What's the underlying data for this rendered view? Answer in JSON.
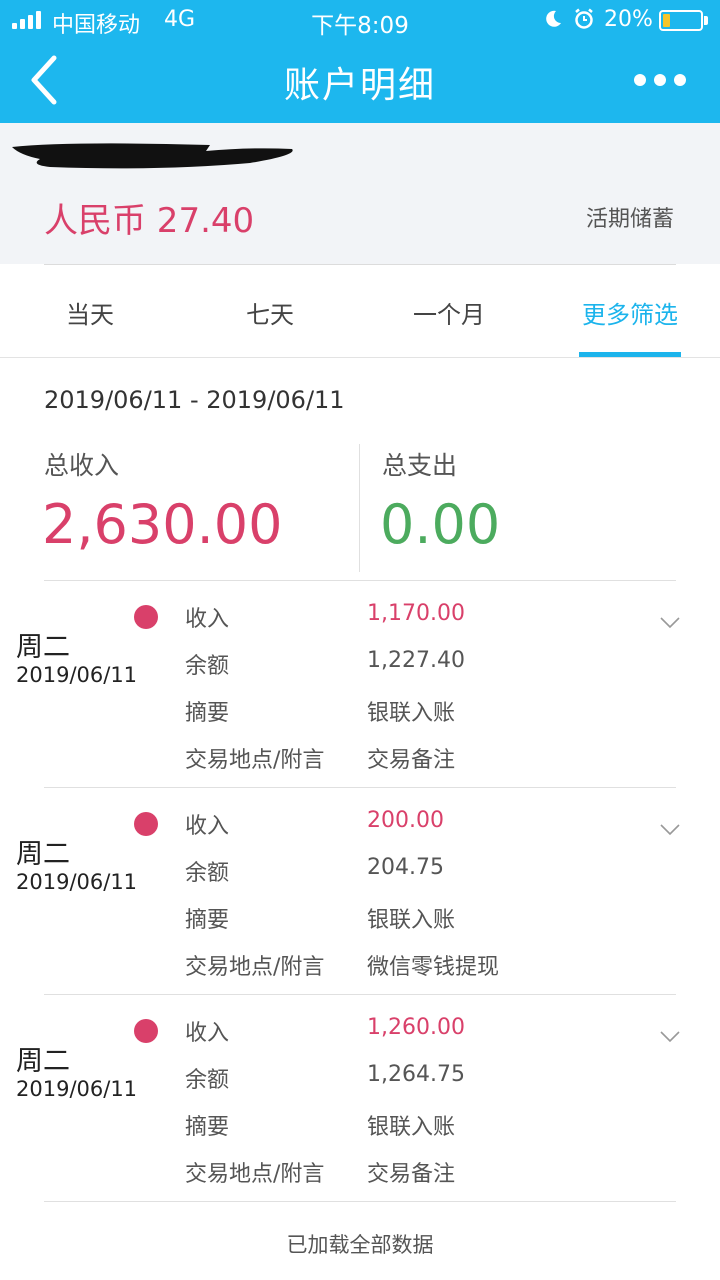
{
  "status_bar": {
    "carrier": "中国移动",
    "network": "4G",
    "time": "下午8:09",
    "battery": "20%",
    "battery_level": 0.2
  },
  "header": {
    "title": "账户明细",
    "back_icon": "chevron-left-icon",
    "more_icon": "more-dots-icon",
    "background": "#1db7ee"
  },
  "account": {
    "balance": "人民币 27.40",
    "type": "活期储蓄"
  },
  "tabs": [
    {
      "label": "当天"
    },
    {
      "label": "七天"
    },
    {
      "label": "一个月"
    },
    {
      "label": "更多筛选",
      "active": true
    }
  ],
  "summary": {
    "date_range": "2019/06/11 - 2019/06/11",
    "income_label": "总收入",
    "income_value": "2,630.00",
    "expense_label": "总支出",
    "expense_value": "0.00",
    "income_color": "#d9406a",
    "expense_color": "#4cab5e"
  },
  "transactions": [
    {
      "weekday": "周二",
      "date": "2019/06/11",
      "rows": [
        {
          "label": "收入",
          "value": "1,170.00"
        },
        {
          "label": "余额",
          "value": "1,227.40"
        },
        {
          "label": "摘要",
          "value": "银联入账"
        },
        {
          "label": "交易地点/附言",
          "value": "交易备注"
        }
      ]
    },
    {
      "weekday": "周二",
      "date": "2019/06/11",
      "rows": [
        {
          "label": "收入",
          "value": "200.00"
        },
        {
          "label": "余额",
          "value": "204.75"
        },
        {
          "label": "摘要",
          "value": "银联入账"
        },
        {
          "label": "交易地点/附言",
          "value": "微信零钱提现"
        }
      ]
    },
    {
      "weekday": "周二",
      "date": "2019/06/11",
      "rows": [
        {
          "label": "收入",
          "value": "1,260.00"
        },
        {
          "label": "余额",
          "value": "1,264.75"
        },
        {
          "label": "摘要",
          "value": "银联入账"
        },
        {
          "label": "交易地点/附言",
          "value": "交易备注"
        }
      ]
    }
  ],
  "footer": "已加载全部数据"
}
